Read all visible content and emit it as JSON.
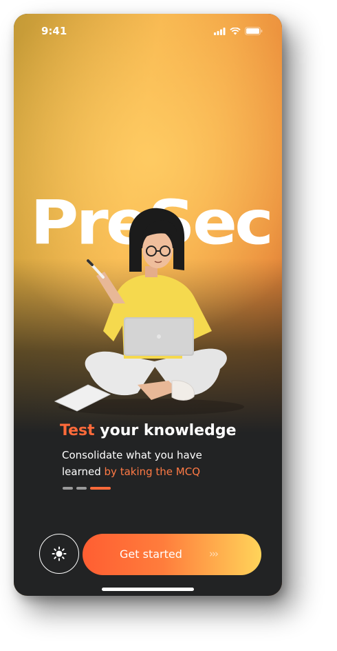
{
  "status_bar": {
    "time": "9:41"
  },
  "brand": {
    "title": "PreSec"
  },
  "onboarding": {
    "headline_accent": "Test",
    "headline_rest": " your knowledge",
    "subtitle_plain": "Consolidate what you have learned ",
    "subtitle_accent": "by taking the MCQ",
    "page_indicator": {
      "total": 3,
      "current": 3
    }
  },
  "actions": {
    "theme_toggle_icon": "sun-icon",
    "cta_label": "Get started",
    "cta_arrows": "›››"
  },
  "colors": {
    "accent": "#ff6a3a",
    "background_dark": "#222324",
    "cta_gradient_start": "#ff5e32",
    "cta_gradient_end": "#ffd45a"
  }
}
